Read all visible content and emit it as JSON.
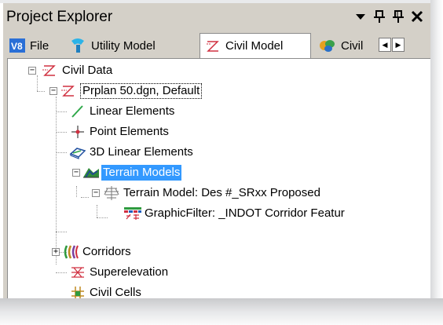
{
  "panel": {
    "title": "Project Explorer",
    "controls": {
      "dropdown": "dropdown",
      "dock": "dock",
      "pin": "pin",
      "close": "close"
    }
  },
  "tabs": [
    {
      "label": "File",
      "icon": "file-v8-icon",
      "active": false
    },
    {
      "label": "Utility Model",
      "icon": "utility-model-icon",
      "active": false
    },
    {
      "label": "Civil Model",
      "icon": "civil-model-icon",
      "active": true
    },
    {
      "label": "Civil",
      "icon": "civil-standards-icon",
      "active": false
    }
  ],
  "tab_scroll": {
    "left": "◀",
    "right": "▶"
  },
  "tree": {
    "expanders": {
      "expanded": "−",
      "collapsed": "+"
    },
    "items": [
      {
        "label": "Civil Data",
        "icon": "civil-data-icon",
        "level": 0,
        "expanded": true
      },
      {
        "label": "Prplan 50.dgn, Default",
        "icon": "civil-model-icon",
        "level": 1,
        "expanded": true,
        "focused": true
      },
      {
        "label": "Linear Elements",
        "icon": "linear-element-icon",
        "level": 2
      },
      {
        "label": "Point Elements",
        "icon": "point-element-icon",
        "level": 2
      },
      {
        "label": "3D Linear Elements",
        "icon": "3d-linear-icon",
        "level": 2
      },
      {
        "label": "Terrain Models",
        "icon": "terrain-models-icon",
        "level": 2,
        "expanded": true,
        "selected": true
      },
      {
        "label": "Terrain Model: Des #_SRxx Proposed",
        "icon": "terrain-model-icon",
        "level": 3,
        "expanded": true
      },
      {
        "label": "GraphicFilter: _INDOT Corridor Featur",
        "icon": "graphic-filter-icon",
        "level": 4
      },
      {
        "label": "Corridors",
        "icon": "corridors-icon",
        "level": 2,
        "expanded": false
      },
      {
        "label": "Superelevation",
        "icon": "superelevation-icon",
        "level": 2
      },
      {
        "label": "Civil Cells",
        "icon": "civil-cells-icon",
        "level": 2
      }
    ]
  },
  "colors": {
    "chrome": "#d4d0c8",
    "selection": "#3399ff",
    "civil_red": "#d03040"
  }
}
